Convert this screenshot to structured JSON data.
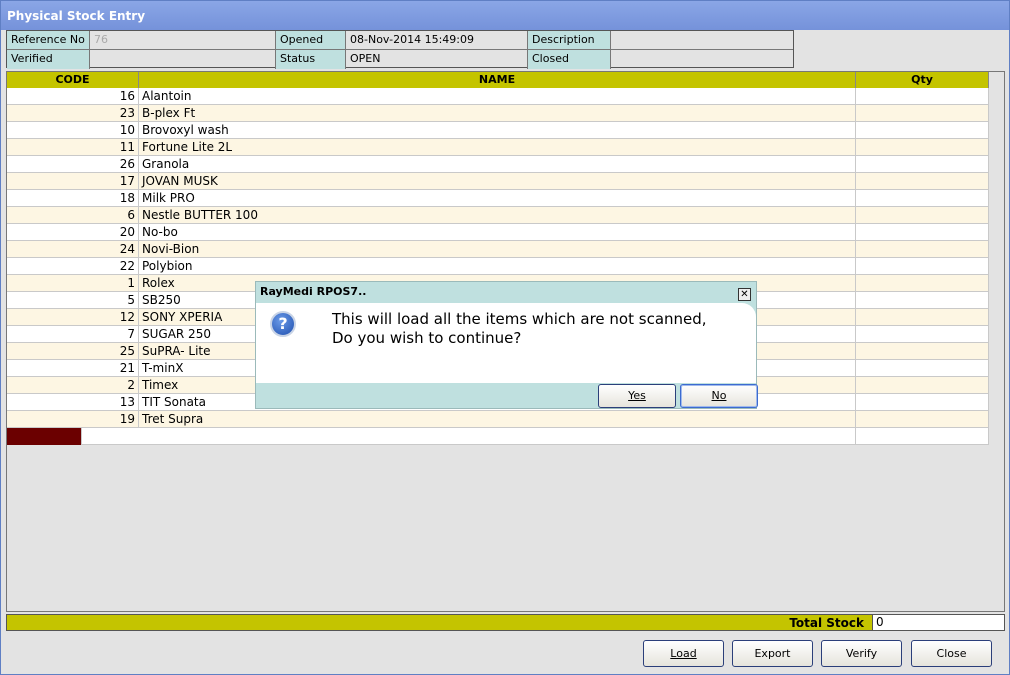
{
  "window": {
    "title": "Physical Stock Entry"
  },
  "info": {
    "reference_no_label": "Reference No",
    "reference_no": "76",
    "opened_label": "Opened",
    "opened": "08-Nov-2014 15:49:09",
    "description_label": "Description",
    "description": "",
    "verified_label": "Verified",
    "verified": "",
    "status_label": "Status",
    "status": "OPEN",
    "closed_label": "Closed",
    "closed": ""
  },
  "grid": {
    "columns": [
      "CODE",
      "NAME",
      "Qty"
    ],
    "rows": [
      {
        "code": "16",
        "name": "Alantoin",
        "qty": ""
      },
      {
        "code": "23",
        "name": "B-plex Ft",
        "qty": ""
      },
      {
        "code": "10",
        "name": "Brovoxyl wash",
        "qty": ""
      },
      {
        "code": "11",
        "name": "Fortune Lite 2L",
        "qty": ""
      },
      {
        "code": "26",
        "name": "Granola",
        "qty": ""
      },
      {
        "code": "17",
        "name": "JOVAN MUSK",
        "qty": ""
      },
      {
        "code": "18",
        "name": "Milk PRO",
        "qty": ""
      },
      {
        "code": "6",
        "name": "Nestle BUTTER 100",
        "qty": ""
      },
      {
        "code": "20",
        "name": "No-bo",
        "qty": ""
      },
      {
        "code": "24",
        "name": "Novi-Bion",
        "qty": ""
      },
      {
        "code": "22",
        "name": "Polybion",
        "qty": ""
      },
      {
        "code": "1",
        "name": "Rolex",
        "qty": ""
      },
      {
        "code": "5",
        "name": "SB250",
        "qty": ""
      },
      {
        "code": "12",
        "name": "SONY XPERIA",
        "qty": ""
      },
      {
        "code": "7",
        "name": "SUGAR 250",
        "qty": ""
      },
      {
        "code": "25",
        "name": "SuPRA- Lite",
        "qty": ""
      },
      {
        "code": "21",
        "name": "T-minX",
        "qty": ""
      },
      {
        "code": "2",
        "name": "Timex",
        "qty": ""
      },
      {
        "code": "13",
        "name": "TIT Sonata",
        "qty": ""
      },
      {
        "code": "19",
        "name": "Tret Supra",
        "qty": ""
      }
    ]
  },
  "footer": {
    "total_label": "Total Stock",
    "total_value": "0"
  },
  "buttons": {
    "load": "Load",
    "export": "Export",
    "verify": "Verify",
    "close": "Close"
  },
  "dialog": {
    "title": "RayMedi RPOS7..",
    "message": "This will load all the items which are not scanned,\nDo you wish to continue?",
    "yes": "Yes",
    "no": "No"
  },
  "colors": {
    "header": "#c4c400",
    "label": "#bfe0df",
    "selected_cell": "#6b0000"
  }
}
